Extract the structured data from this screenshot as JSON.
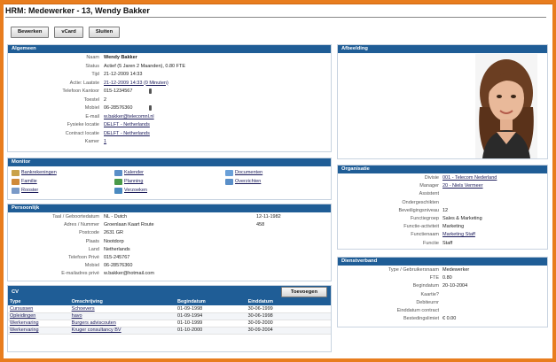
{
  "title": "HRM: Medewerker - 13, Wendy Bakker",
  "toolbar": {
    "edit": "Bewerken",
    "vcard": "vCard",
    "close": "Sluiten"
  },
  "algemeen": {
    "header": "Algemeen",
    "fields": [
      {
        "label": "Naam",
        "value": "Wendy Bakker",
        "bold": true
      },
      {
        "label": "Status",
        "value": "Actief (5 Jaren 2 Maanden), 0.80 FTE"
      },
      {
        "label": "Tijd",
        "value": "21-12-2009 14:33"
      },
      {
        "label": "Actie: Laatste",
        "value": "21-12-2009 14:33 (0 Minuten)",
        "link": true
      },
      {
        "label": "Telefoon Kantoor",
        "value": "015-1234567",
        "phone": true
      },
      {
        "label": "Toestel",
        "value": "2"
      },
      {
        "label": "Mobiel",
        "value": "06-28576360",
        "phone": true
      },
      {
        "label": "E-mail",
        "value": "w.bakker@telecomnl.nl",
        "link": true
      },
      {
        "label": "Fysieke locatie",
        "value": "DELFT - Netherlands",
        "link": true
      },
      {
        "label": "Contract locatie",
        "value": "DELFT - Netherlands",
        "link": true
      },
      {
        "label": "Kamer",
        "value": "1",
        "link": true
      }
    ]
  },
  "afbeelding": {
    "header": "Afbeelding"
  },
  "monitor": {
    "header": "Monitor",
    "items": [
      {
        "label": "Bankrekeningen",
        "icon": "bank-icon",
        "color": "#c9a24a"
      },
      {
        "label": "Kalender",
        "icon": "calendar-icon",
        "color": "#5a8fc8"
      },
      {
        "label": "Documenten",
        "icon": "documents-icon",
        "color": "#6aa0d8"
      },
      {
        "label": "Familie",
        "icon": "family-icon",
        "color": "#d08a3a"
      },
      {
        "label": "Planning",
        "icon": "planning-icon",
        "color": "#4a9a4a"
      },
      {
        "label": "Overzichten",
        "icon": "overview-icon",
        "color": "#5a8fc8"
      },
      {
        "label": "Rooster",
        "icon": "schedule-icon",
        "color": "#7a9ac8"
      },
      {
        "label": "Verzoeken",
        "icon": "requests-icon",
        "color": "#4a8ac0"
      }
    ]
  },
  "persoonlijk": {
    "header": "Persoonlijk",
    "fields": [
      {
        "label": "Taal / Geboortedatum",
        "value": "NL - Dutch",
        "extra": "12-11-1982"
      },
      {
        "label": "Adres / Nummer",
        "value": "Groenlaan Kaart Route",
        "extra": "458"
      },
      {
        "label": "Postcode",
        "value": "2631 GR"
      },
      {
        "label": "Plaats",
        "value": "Nootdorp"
      },
      {
        "label": "Land",
        "value": "Netherlands"
      },
      {
        "label": "Telefoon Privé",
        "value": "015-245767"
      },
      {
        "label": "Mobiel",
        "value": "06-28576360"
      },
      {
        "label": "E-mailadres privé",
        "value": "w.bakker@hotmail.com"
      }
    ]
  },
  "organisatie": {
    "header": "Organisatie",
    "fields": [
      {
        "label": "Divisie",
        "value": "001 - Telecom Nederland",
        "link": true
      },
      {
        "label": "Manager",
        "value": "20 - Niels Vermeer",
        "link": true
      },
      {
        "label": "Assistent",
        "value": ""
      },
      {
        "label": "Ondergeschikten",
        "value": ""
      },
      {
        "label": "Beveiligingsniveau",
        "value": "12"
      },
      {
        "label": "Functiegroep",
        "value": "Sales & Marketing"
      },
      {
        "label": "Functie-activiteit",
        "value": "Marketing"
      },
      {
        "label": "Functienaam",
        "value": "Marketing Staff",
        "link": true
      },
      {
        "label": "Functie",
        "value": "Staff"
      }
    ]
  },
  "dienstverband": {
    "header": "Dienstverband",
    "fields": [
      {
        "label": "Type / Gebruikersnaam",
        "value": "Medewerker"
      },
      {
        "label": "FTE",
        "value": "0.80"
      },
      {
        "label": "Begindatum",
        "value": "20-10-2004"
      },
      {
        "label": "Kaartie?",
        "value": ""
      },
      {
        "label": "Debiteurnr",
        "value": ""
      },
      {
        "label": "Einddatum contract",
        "value": ""
      },
      {
        "label": "Bestedingslimiet",
        "value": "€ 0.00"
      }
    ]
  },
  "cv": {
    "header": "CV",
    "add_button": "Toevoegen",
    "columns": [
      "Type",
      "Omschrijving",
      "Begindatum",
      "Einddatum"
    ],
    "rows": [
      [
        "Cursussen",
        "Schoevers",
        "01-09-1998",
        "30-06-1999"
      ],
      [
        "Opleidingen",
        "havo",
        "01-09-1994",
        "30-06-1998"
      ],
      [
        "Werkervaring",
        "Burgers adviscouten",
        "01-10-1999",
        "30-09-2000"
      ],
      [
        "Werkervaring",
        "Kruger consultancy BV",
        "01-10-2000",
        "30-09-2004"
      ]
    ]
  }
}
